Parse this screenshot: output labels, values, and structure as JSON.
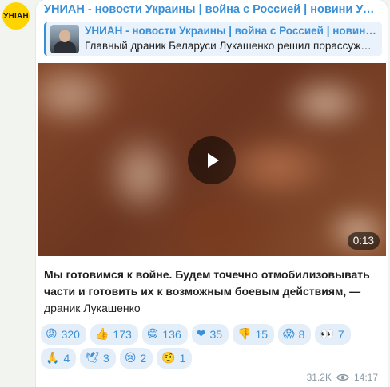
{
  "channel": {
    "avatar_text": "УНІАН",
    "name": "УНИАН - новости Украины | война с Россией | новини України | війна з Росією"
  },
  "reply": {
    "title": "УНИАН - новости Украины | война с Россией | новини України | війна з Росією",
    "text": "Главный драник Беларуси Лукашенко решил порассуждать о войне"
  },
  "video": {
    "duration": "0:13"
  },
  "caption": {
    "bold": "Мы готовимся к войне. Будем точечно отмобилизовывать части и готовить их к возможным боевым действиям, —",
    "plain": "драник Лукашенко"
  },
  "reactions": [
    {
      "icon": "angry-face-icon",
      "emoji": "😡",
      "color": "#e0452b",
      "count": "320"
    },
    {
      "icon": "thumbs-up-icon",
      "emoji": "👍",
      "color": "#f4b400",
      "count": "173"
    },
    {
      "icon": "grinning-face-icon",
      "emoji": "😁",
      "color": "#f4b400",
      "count": "136"
    },
    {
      "icon": "red-heart-icon",
      "emoji": "❤",
      "color": "#e0245e",
      "count": "35"
    },
    {
      "icon": "thumbs-down-icon",
      "emoji": "👎",
      "color": "#f4b400",
      "count": "15"
    },
    {
      "icon": "screaming-face-icon",
      "emoji": "😱",
      "color": "#f4b400",
      "count": "8"
    },
    {
      "icon": "eyes-icon",
      "emoji": "👀",
      "color": "#ffffff",
      "count": "7"
    },
    {
      "icon": "folded-hands-icon",
      "emoji": "🙏",
      "color": "#f4b400",
      "count": "4"
    },
    {
      "icon": "dove-icon",
      "emoji": "🕊",
      "color": "#9aa5ad",
      "count": "3"
    },
    {
      "icon": "crying-face-icon",
      "emoji": "😢",
      "color": "#f4b400",
      "count": "2"
    },
    {
      "icon": "neutral-face-icon",
      "emoji": "🤨",
      "color": "#f4b400",
      "count": "1"
    }
  ],
  "meta": {
    "views": "31.2K",
    "time": "14:17"
  },
  "colors": {
    "accent": "#3a8fd6",
    "reaction_bg": "#e3eef9",
    "avatar_bg": "#ffd400"
  }
}
